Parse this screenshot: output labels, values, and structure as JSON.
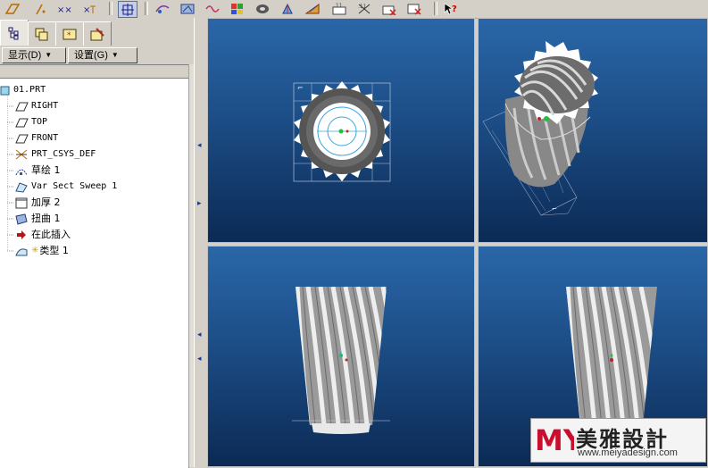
{
  "toolbar": {
    "icons": [
      "sketch-datum-icon",
      "datum-point-icon",
      "datum-axis-icon",
      "csys-icon",
      "view-orient-icon",
      "view-box-icon",
      "spin-center-icon",
      "shading-icon",
      "repaint-icon",
      "layer-icon",
      "model-tree-icon",
      "saved-views-icon",
      "appearance-icon",
      "setup-icon",
      "regen-icon",
      "analysis-icon",
      "context-help-icon"
    ]
  },
  "panel": {
    "tabs": [
      "model-tree-tab",
      "layer-tab",
      "favorites-tab",
      "history-tab"
    ],
    "show_menu": "显示(D)",
    "settings_menu": "设置(G)"
  },
  "tree": {
    "items": [
      {
        "label": "01.PRT",
        "icon": "part-icon"
      },
      {
        "label": "RIGHT",
        "icon": "datum-plane-icon"
      },
      {
        "label": "TOP",
        "icon": "datum-plane-icon"
      },
      {
        "label": "FRONT",
        "icon": "datum-plane-icon"
      },
      {
        "label": "PRT_CSYS_DEF",
        "icon": "csys-icon"
      },
      {
        "label": "草绘 1",
        "icon": "sketch-icon"
      },
      {
        "label": "Var Sect Sweep 1",
        "icon": "sweep-icon"
      },
      {
        "label": "加厚 2",
        "icon": "thicken-icon"
      },
      {
        "label": "扭曲 1",
        "icon": "warp-icon"
      },
      {
        "label": "在此插入",
        "icon": "insert-here-arrow-icon"
      },
      {
        "label": "类型 1",
        "icon": "style-icon"
      }
    ]
  },
  "watermark": {
    "logo": "MY",
    "title": "美雅設計",
    "url": "www.meiyadesign.com"
  },
  "colors": {
    "viewport_top": "#2a67a8",
    "viewport_bottom": "#0b2a55",
    "panel": "#d4d0c8",
    "watermark_red": "#c8102e"
  }
}
